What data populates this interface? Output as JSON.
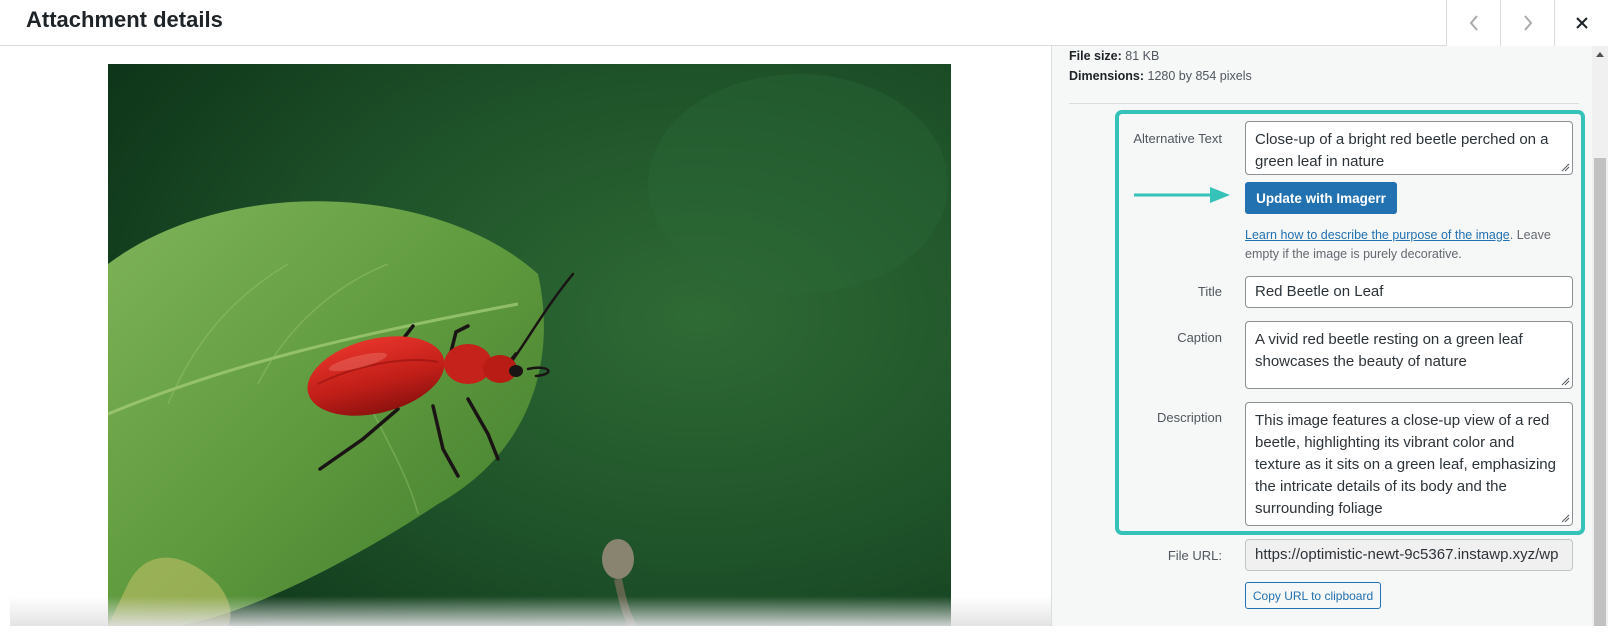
{
  "header": {
    "title": "Attachment details",
    "prev_icon": "chevron-left-icon",
    "next_icon": "chevron-right-icon",
    "close_icon": "close-icon"
  },
  "image": {
    "subject": "red beetle on green leaf"
  },
  "file_info": {
    "file_size_label": "File size:",
    "file_size_value": "81 KB",
    "dimensions_label": "Dimensions:",
    "dimensions_value": "1280 by 854 pixels"
  },
  "form": {
    "alt_text_label": "Alternative Text",
    "alt_text_value": "Close-up of a bright red beetle perched on a green leaf in nature",
    "update_button_label": "Update with Imagerr",
    "help_link": "Learn how to describe the purpose of the image",
    "help_text": ". Leave empty if the image is purely decorative.",
    "title_label": "Title",
    "title_value": "Red Beetle on Leaf",
    "caption_label": "Caption",
    "caption_value": "A vivid red beetle resting on a green leaf showcases the beauty of nature",
    "description_label": "Description",
    "description_value": "This image features a close-up view of a red beetle, highlighting its vibrant color and texture as it sits on a green leaf, emphasizing the intricate details of its body and the surrounding foliage",
    "file_url_label": "File URL:",
    "file_url_value": "https://optimistic-newt-9c5367.instawp.xyz/wp",
    "copy_button_label": "Copy URL to clipboard"
  },
  "colors": {
    "primary_button": "#2271b1",
    "highlight_border": "#35c2b8",
    "arrow": "#35c2b8"
  }
}
